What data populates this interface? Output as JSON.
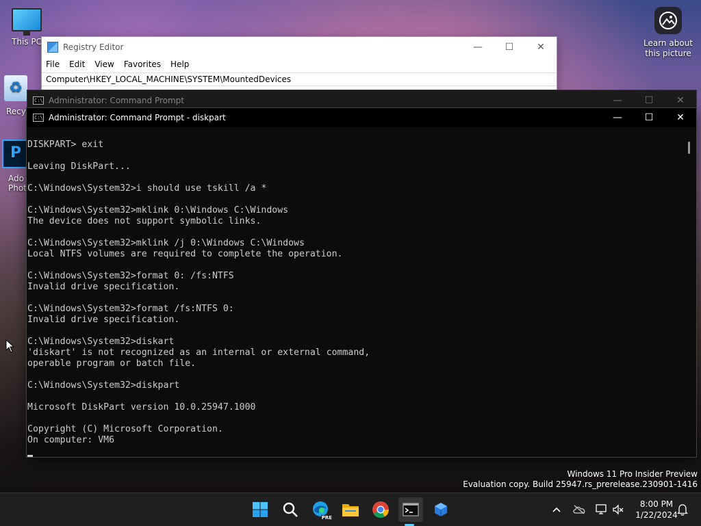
{
  "desktop": {
    "icons": [
      {
        "label": "This PC"
      },
      {
        "label": "Recyc"
      },
      {
        "label": "Ado",
        "label2": "Phot"
      }
    ],
    "learn": {
      "line1": "Learn about",
      "line2": "this picture"
    }
  },
  "regedit": {
    "title": "Registry Editor",
    "menu": [
      "File",
      "Edit",
      "View",
      "Favorites",
      "Help"
    ],
    "address": "Computer\\HKEY_LOCAL_MACHINE\\SYSTEM\\MountedDevices"
  },
  "cmd_back": {
    "title": "Administrator: Command Prompt"
  },
  "cmd": {
    "title": "Administrator: Command Prompt - diskpart",
    "lines": [
      "DISKPART> exit",
      "",
      "Leaving DiskPart...",
      "",
      "C:\\Windows\\System32>i should use tskill /a *",
      "",
      "C:\\Windows\\System32>mklink 0:\\Windows C:\\Windows",
      "The device does not support symbolic links.",
      "",
      "C:\\Windows\\System32>mklink /j 0:\\Windows C:\\Windows",
      "Local NTFS volumes are required to complete the operation.",
      "",
      "C:\\Windows\\System32>format 0: /fs:NTFS",
      "Invalid drive specification.",
      "",
      "C:\\Windows\\System32>format /fs:NTFS 0:",
      "Invalid drive specification.",
      "",
      "C:\\Windows\\System32>diskart",
      "'diskart' is not recognized as an internal or external command,",
      "operable program or batch file.",
      "",
      "C:\\Windows\\System32>diskpart",
      "",
      "Microsoft DiskPart version 10.0.25947.1000",
      "",
      "Copyright (C) Microsoft Corporation.",
      "On computer: VM6"
    ]
  },
  "watermark": {
    "line1": "Windows 11 Pro Insider Preview",
    "line2": "Evaluation copy. Build 25947.rs_prerelease.230901-1416"
  },
  "taskbar": {
    "icons": [
      "start-icon",
      "search-icon",
      "edge-icon",
      "file-explorer-icon",
      "chrome-icon",
      "terminal-icon",
      "regedit-icon"
    ],
    "edge_badge": "PRE",
    "clock": {
      "time": "8:00 PM",
      "date": "1/22/2024"
    }
  },
  "colors": {
    "console_bg": "#0c0c0c",
    "console_text": "#cccccc",
    "taskbar_bg": "#1f1f1f",
    "accent": "#60cdff"
  }
}
